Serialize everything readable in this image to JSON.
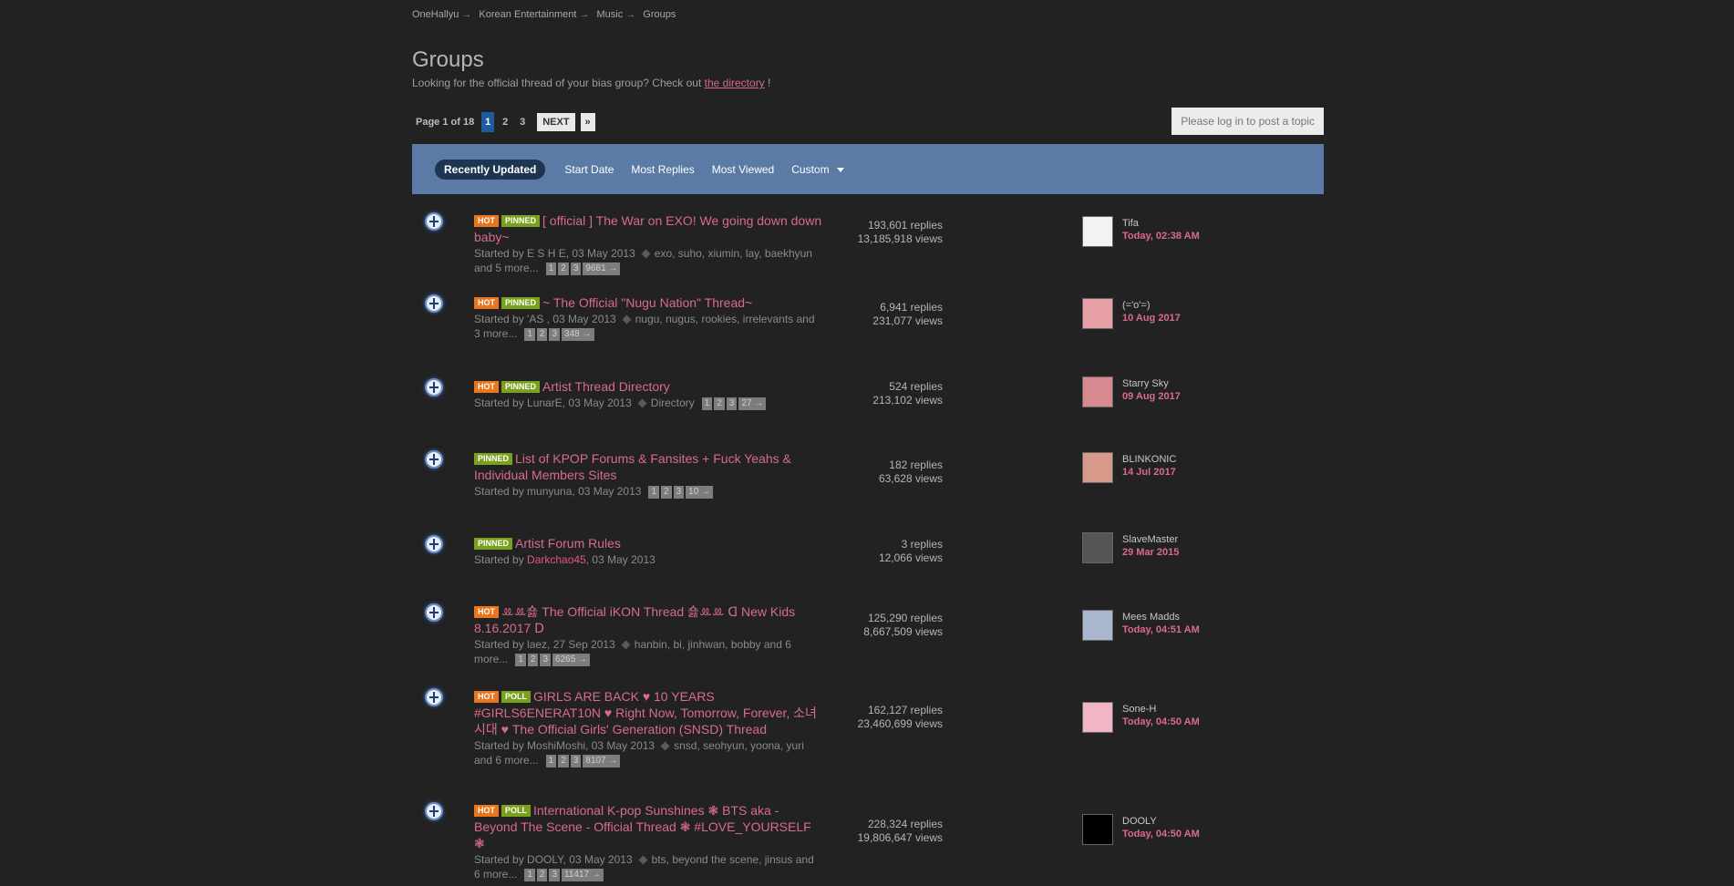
{
  "breadcrumb": [
    {
      "label": "OneHallyu"
    },
    {
      "label": "Korean Entertainment"
    },
    {
      "label": "Music"
    },
    {
      "label": "Groups"
    }
  ],
  "breadcrumb_sep": "→",
  "title": "Groups",
  "description": {
    "before": "Looking for the official thread of your bias group? Check out",
    "link": "the directory",
    "after": " !"
  },
  "pagination": {
    "label": "Page 1 of 18",
    "pages": [
      "1",
      "2",
      "3"
    ],
    "next": "NEXT",
    "last": "»"
  },
  "login_button": "Please log in to post a topic",
  "filters": {
    "active": "Recently Updated",
    "tabs": [
      "Start Date",
      "Most Replies",
      "Most Viewed"
    ],
    "custom": "Custom"
  },
  "topics": [
    {
      "badges": [
        "HOT",
        "PINNED"
      ],
      "title": "[ official ] The War on EXO! We going down down baby~",
      "starter": "Started by E S H E, 03 May 2013",
      "tags": "exo, suho, xiumin, lay, baekhyun and 5 more...",
      "pages": [
        "1",
        "2",
        "3",
        "9681 →"
      ],
      "replies": "193,601 replies",
      "views": "13,185,918 views",
      "last_user": "Tifa",
      "last_time": "Today, 02:38 AM",
      "avatar_color": "#f2f2f2"
    },
    {
      "badges": [
        "HOT",
        "PINNED"
      ],
      "title": "~ The Official \"Nugu Nation\" Thread~",
      "starter": "Started by 'AS , 03 May 2013",
      "tags": "nugu, nugus, rookies, irrelevants and 3 more...",
      "pages": [
        "1",
        "2",
        "3",
        "348 →"
      ],
      "replies": "6,941 replies",
      "views": "231,077 views",
      "last_user": "(='o'=)",
      "last_time": "10 Aug 2017",
      "avatar_color": "#e7a0a6"
    },
    {
      "badges": [
        "HOT",
        "PINNED"
      ],
      "title": "Artist Thread Directory",
      "starter": "Started by LunarE, 03 May 2013",
      "tags": "Directory",
      "pages": [
        "1",
        "2",
        "3",
        "27 →"
      ],
      "replies": "524 replies",
      "views": "213,102 views",
      "last_user": "Starry Sky",
      "last_time": "09 Aug 2017",
      "avatar_color": "#d98a90"
    },
    {
      "badges": [
        "PINNED"
      ],
      "title": "List of KPOP Forums & Fansites + Fuck Yeahs & Individual Members Sites",
      "starter": "Started by munyuna, 03 May 2013",
      "tags": "",
      "pages": [
        "1",
        "2",
        "3",
        "10 →"
      ],
      "replies": "182 replies",
      "views": "63,628 views",
      "last_user": "BLINKONIC",
      "last_time": "14 Jul 2017",
      "avatar_color": "#d79a8a"
    },
    {
      "badges": [
        "PINNED"
      ],
      "title": "Artist Forum Rules",
      "starter_prefix": "Started by ",
      "starter_name": "Darkchao45",
      "starter_suffix": ", 03 May 2013",
      "tags": "",
      "pages": [],
      "replies": "3 replies",
      "views": "12,066 views",
      "last_user": "SlaveMaster",
      "last_time": "29 Mar 2015",
      "avatar_color": "#555555"
    },
    {
      "badges": [
        "HOT"
      ],
      "title": "ꔛꔛ숋 The Official iKON Thread 숋ꔛꔛ ᗡ New Kids 8.16.2017 ᗞ",
      "starter": "Started by laez, 27 Sep 2013",
      "tags": "hanbin, bi, jinhwan, bobby and 6 more...",
      "pages": [
        "1",
        "2",
        "3",
        "6265 →"
      ],
      "replies": "125,290 replies",
      "views": "8,667,509 views",
      "last_user": "Mees Madds",
      "last_time": "Today, 04:51 AM",
      "avatar_color": "#a9b7cf"
    },
    {
      "badges": [
        "HOT",
        "POLL"
      ],
      "title": "GIRLS ARE BACK ♥ 10 YEARS #GIRLS6ENERAT10N ♥ Right Now, Tomorrow, Forever, 소녀시대 ♥ The Official Girls' Generation (SNSD) Thread",
      "starter": "Started by MoshiMoshi, 03 May 2013",
      "tags": "snsd, seohyun, yoona, yuri and 6 more...",
      "pages": [
        "1",
        "2",
        "3",
        "8107 →"
      ],
      "replies": "162,127 replies",
      "views": "23,460,699 views",
      "last_user": "Sone-H",
      "last_time": "Today, 04:50 AM",
      "avatar_color": "#f1b6c6"
    },
    {
      "badges": [
        "HOT",
        "POLL"
      ],
      "title": "International K-pop Sunshines ❃ BTS aka - Beyond The Scene - Official Thread ❃ #LOVE_YOURSELF ❃",
      "starter": "Started by DOOLY, 03 May 2013",
      "tags": "bts, beyond the scene, jinsus and 6 more...",
      "pages": [
        "1",
        "2",
        "3",
        "11417 →"
      ],
      "replies": "228,324 replies",
      "views": "19,806,647 views",
      "last_user": "DOOLY",
      "last_time": "Today, 04:50 AM",
      "avatar_color": "#000000"
    }
  ],
  "colors": {
    "background": "#222222",
    "accent_link": "#d96b8a",
    "filterbar": "#5b7aa5",
    "hot": "#e9761c",
    "pinned": "#7aa11e",
    "page_active": "#1f5aa1"
  }
}
